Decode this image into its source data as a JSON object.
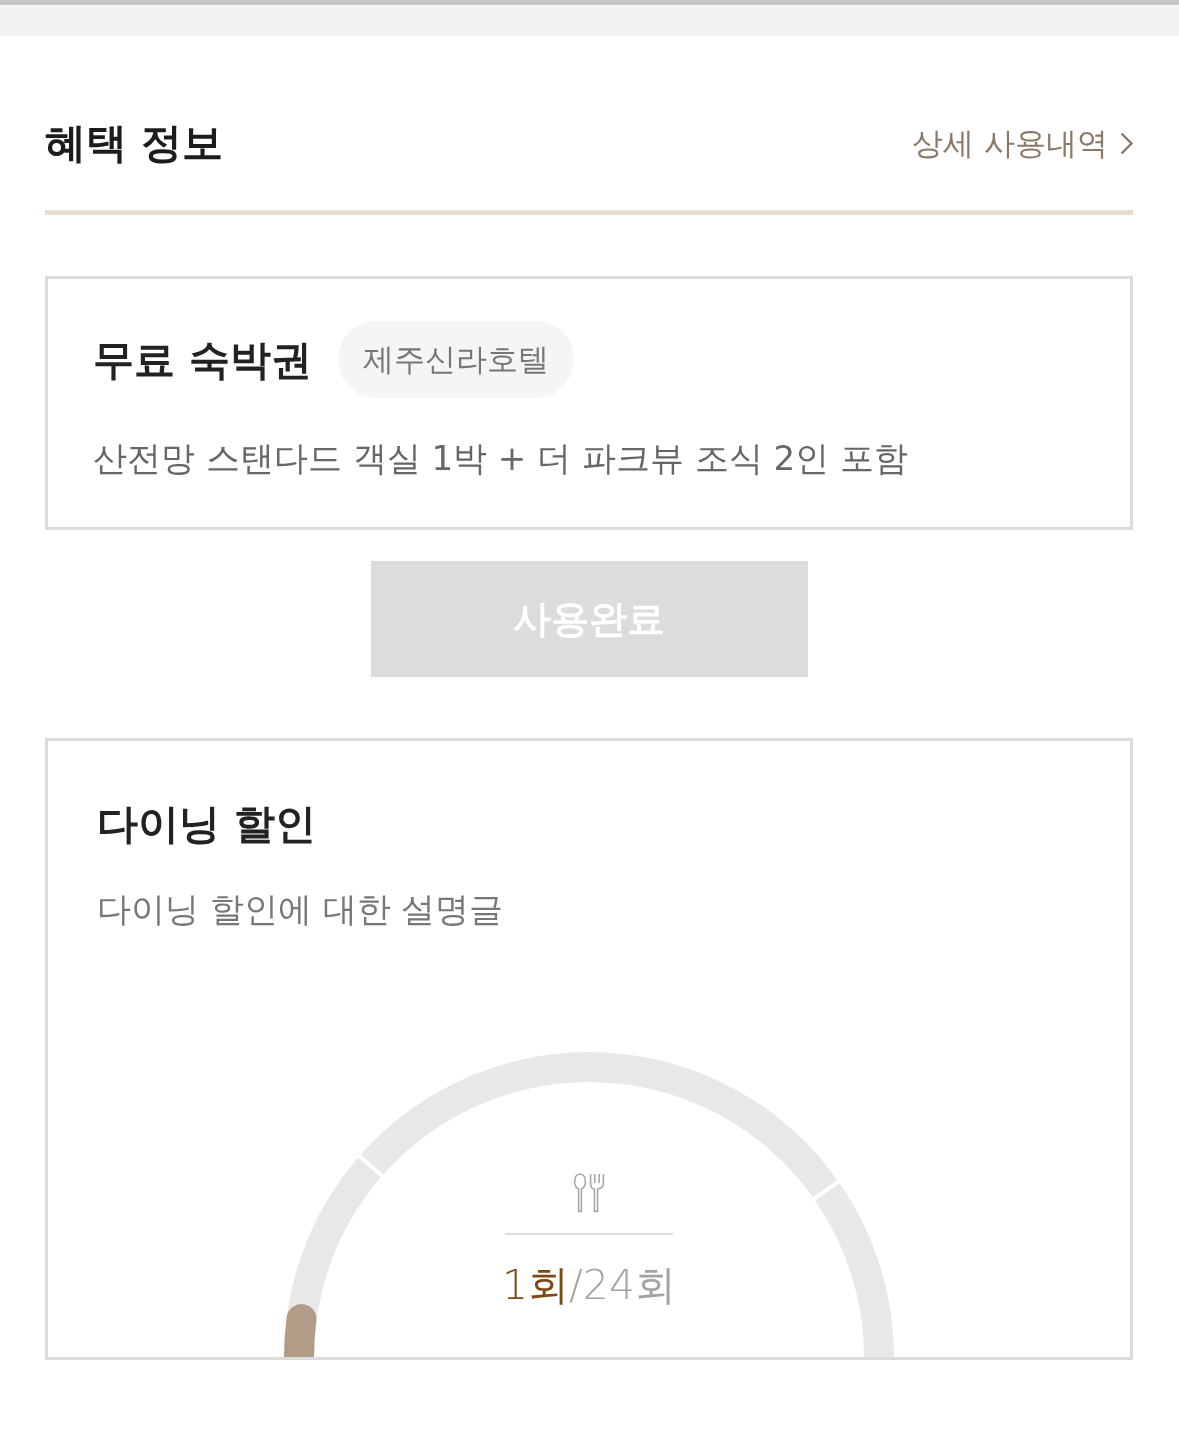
{
  "header": {
    "title": "혜택 정보",
    "link": "상세 사용내역"
  },
  "benefits": [
    {
      "kind": "voucher",
      "title": "무료 숙박권",
      "tag": "제주신라호텔",
      "description": "산전망 스탠다드 객실 1박 + 더 파크뷰 조식 2인 포함",
      "button": {
        "label": "사용완료",
        "disabled": true
      }
    },
    {
      "kind": "gauge",
      "title": "다이닝 할인",
      "description": "다이닝 할인에 대한 설명글",
      "gauge": {
        "level": 0.0417,
        "used": "1회",
        "total": "/24회"
      }
    }
  ]
}
